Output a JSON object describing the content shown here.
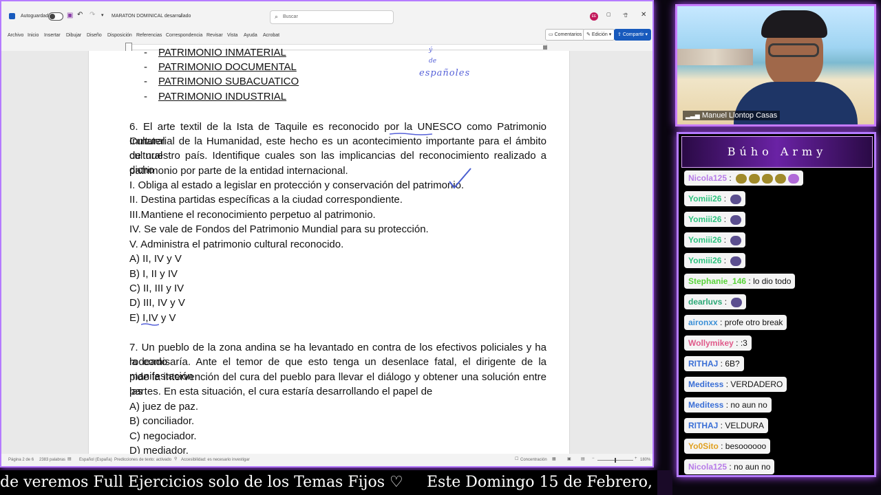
{
  "word": {
    "autosave_label": "Autoguardado",
    "doc_title": "MARATON DOMINICAL desarrollado",
    "search_placeholder": "Buscar",
    "menu": [
      "Archivo",
      "Inicio",
      "Insertar",
      "Dibujar",
      "Diseño",
      "Disposición",
      "Referencias",
      "Correspondencia",
      "Revisar",
      "Vista",
      "Ayuda",
      "Acrobat"
    ],
    "comments_label": "Comentarios",
    "edit_label": "Edición",
    "share_label": "Compartir",
    "user_initials": "EE"
  },
  "document": {
    "bullets": [
      "PATRIMONIO INMATERIAL",
      "PATRIMONIO DOCUMENTAL",
      "PATRIMONIO SUBACUATICO",
      "PATRIMONIO INDUSTRIAL"
    ],
    "handwriting": "españoles",
    "q6_lines": [
      "6. El arte textil de la Ista de Taquile es reconocido por la UNESCO como Patrimonio Cultural",
      "Inmaterial de la Humanidad, este hecho es un acontecimiento importante para el ámbito cultural",
      "de nuestro país. Identifique cuales son las implicancias del reconocimiento realizado a dicho",
      "patrimonio por parte de la entidad internacional."
    ],
    "q6_items": [
      "I.  Obliga al estado a legislar en protección y conservación del patrimonio.",
      "II. Destina partidas específicas a la ciudad correspondiente.",
      "III.Mantiene el reconocimiento perpetuo al patrimonio.",
      "IV.  Se vale de Fondos del Patrimonio Mundial para su protección.",
      "V. Administra el patrimonio cultural reconocido."
    ],
    "q6_options": [
      "A) II, IV y V",
      "B) I, II y IV",
      "C) II, III y IV",
      "D) III, IV y V",
      "E) I,IV y V"
    ],
    "q7_lines": [
      "7. Un pueblo de la zona andina se ha levantado en contra de los efectivos policiales y ha rodeado",
      "la comisaría. Ante el temor de que esto tenga un desenlace fatal, el dirigente de la manifestación",
      "pide la intervención del cura del pueblo para llevar el diálogo y obtener una solución entre las",
      "partes. En esta situación, el cura estaría desarrollando el papel de"
    ],
    "q7_options": [
      "A) juez de paz.",
      "B) conciliador.",
      "C) negociador.",
      "D) mediador."
    ]
  },
  "status": {
    "page": "Página 2 de 6",
    "words": "2383 palabras",
    "language": "Español (España)",
    "predictions": "Predicciones de texto: activado",
    "accessibility": "Accesibilidad: es necesario investigar",
    "focus": "Concentración",
    "zoom": "180%"
  },
  "cam": {
    "name": "Manuel Llontop Casas"
  },
  "chat": {
    "title": "Búho Army",
    "messages": [
      {
        "user": "Nicola125",
        "text": "",
        "color": "#b77be8",
        "emotes": 5
      },
      {
        "user": "Yomiii26",
        "text": "",
        "color": "#2ec27e",
        "emotes": 1
      },
      {
        "user": "Yomiii26",
        "text": "",
        "color": "#2ec27e",
        "emotes": 1
      },
      {
        "user": "Yomiii26",
        "text": "",
        "color": "#2ec27e",
        "emotes": 1
      },
      {
        "user": "Yomiii26",
        "text": "",
        "color": "#2ec27e",
        "emotes": 1
      },
      {
        "user": "Stephanie_146",
        "text": "lo dio todo",
        "color": "#57d438",
        "emotes": 0
      },
      {
        "user": "dearluvs",
        "text": "",
        "color": "#2aa876",
        "emotes": 1
      },
      {
        "user": "aironxx",
        "text": "profe otro break",
        "color": "#3a8fd6",
        "emotes": 0
      },
      {
        "user": "Wollymikey",
        "text": ":3",
        "color": "#e05a8a",
        "emotes": 0
      },
      {
        "user": "RITHAJ",
        "text": "6B?",
        "color": "#3a6fd6",
        "emotes": 0
      },
      {
        "user": "Meditess",
        "text": "VERDADERO",
        "color": "#3a6fd6",
        "emotes": 0
      },
      {
        "user": "Meditess",
        "text": "no aun no",
        "color": "#3a6fd6",
        "emotes": 0
      },
      {
        "user": "RITHAJ",
        "text": "VELDURA",
        "color": "#3a6fd6",
        "emotes": 0
      },
      {
        "user": "Yo0Sito",
        "text": "besoooooo",
        "color": "#e0a020",
        "emotes": 0
      },
      {
        "user": "Nicola125",
        "text": "no aun no",
        "color": "#b77be8",
        "emotes": 0
      }
    ]
  },
  "ticker": {
    "left": "de veremos Full Ejercicios solo de los Temas Fijos ♡",
    "right": "Este Domingo 15 de Febrero, des"
  }
}
